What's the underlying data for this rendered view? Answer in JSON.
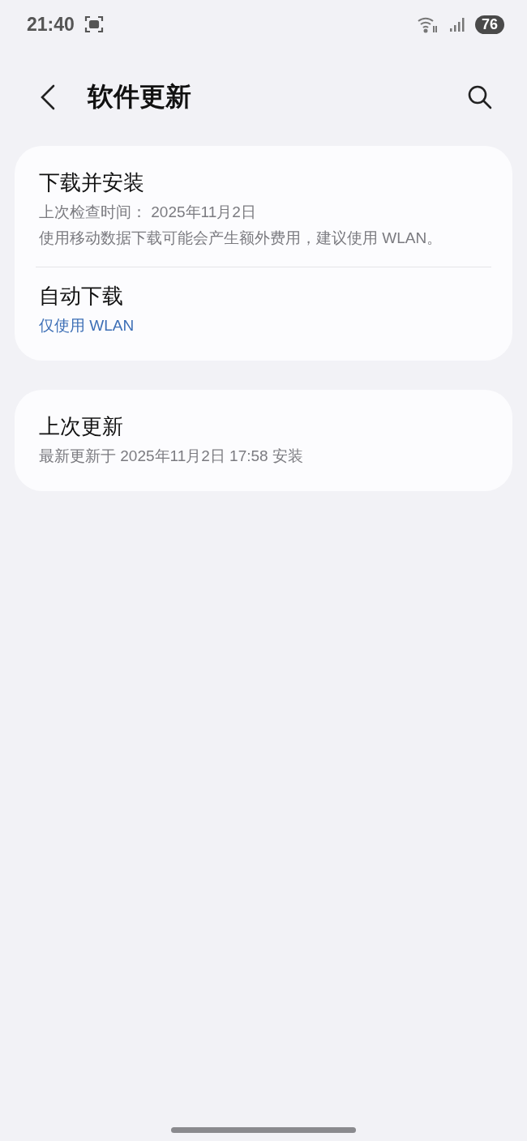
{
  "status_bar": {
    "time": "21:40",
    "battery": "76"
  },
  "header": {
    "title": "软件更新"
  },
  "cards": [
    {
      "rows": [
        {
          "title": "下载并安装",
          "lines": [
            {
              "kind": "secondary",
              "text": "上次检查时间： 2025年11月2日"
            },
            {
              "kind": "secondary",
              "text": "使用移动数据下载可能会产生额外费用，建议使用 WLAN。"
            }
          ]
        },
        {
          "title": "自动下载",
          "lines": [
            {
              "kind": "value",
              "text": "仅使用 WLAN"
            }
          ]
        }
      ]
    },
    {
      "rows": [
        {
          "title": "上次更新",
          "lines": [
            {
              "kind": "secondary",
              "text": "最新更新于 2025年11月2日 17:58 安装"
            }
          ]
        }
      ]
    }
  ]
}
